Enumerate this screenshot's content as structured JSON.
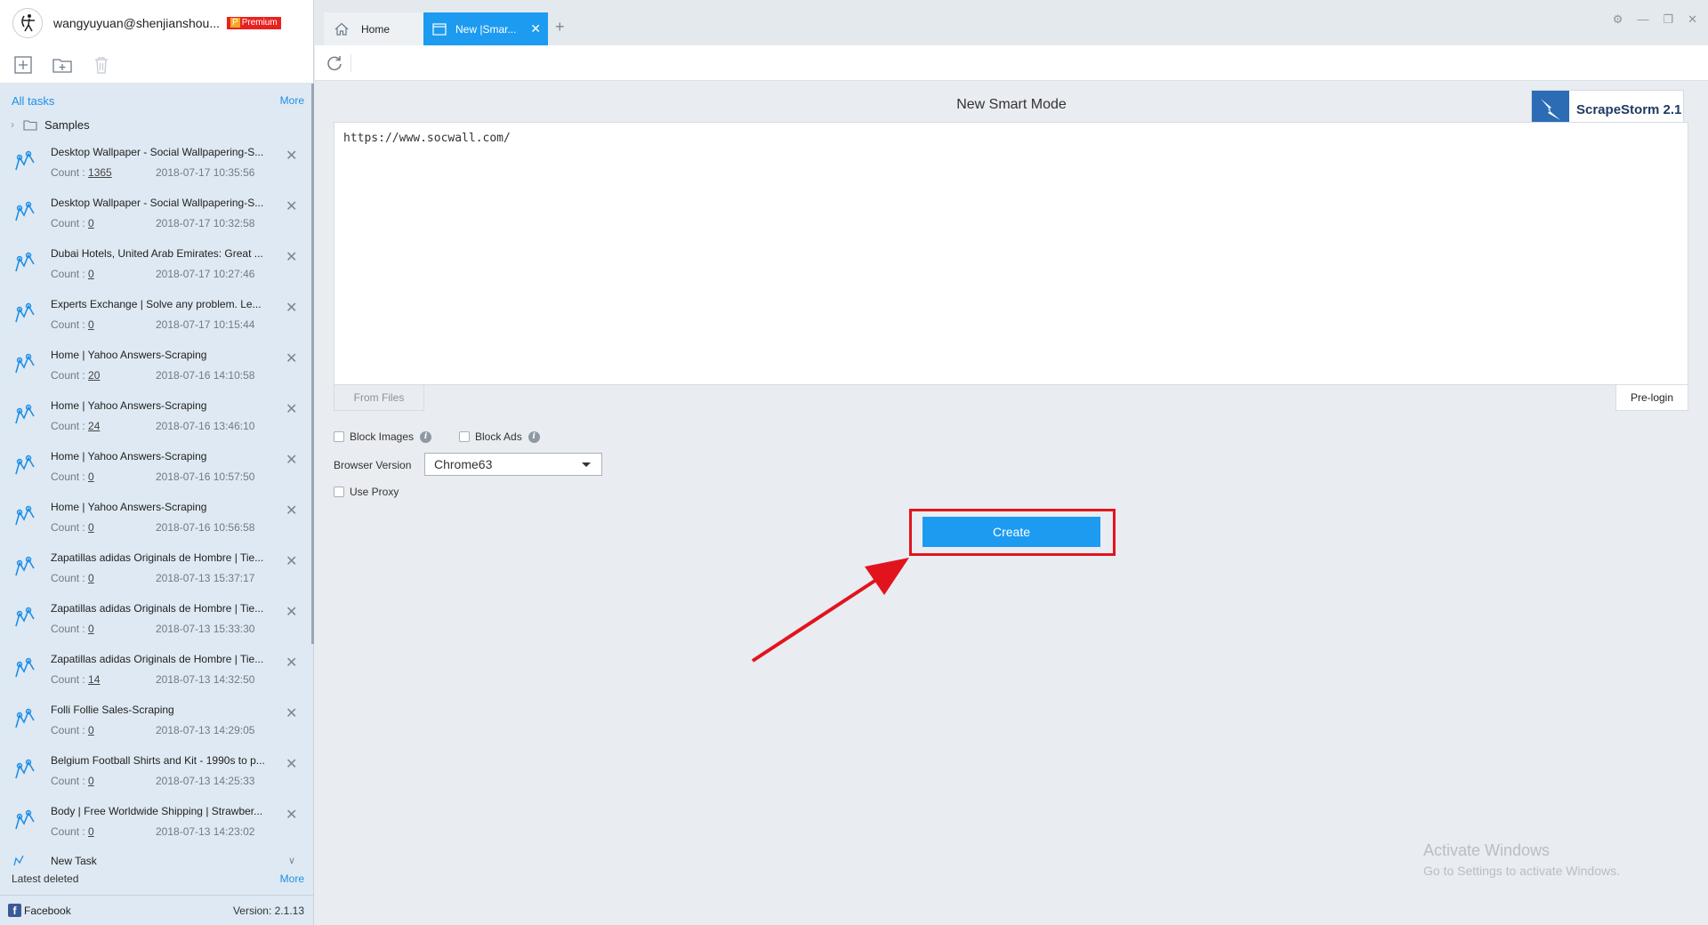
{
  "user": {
    "name": "wangyuyuan@shenjianshou...",
    "badge_p": "P",
    "badge": "Premium"
  },
  "sidebar": {
    "all_tasks": "All tasks",
    "more": "More",
    "samples": "Samples",
    "tasks": [
      {
        "title": "Desktop Wallpaper - Social Wallpapering-S...",
        "count_label": "Count : ",
        "count": "1365",
        "date": "2018-07-17 10:35:56"
      },
      {
        "title": "Desktop Wallpaper - Social Wallpapering-S...",
        "count_label": "Count : ",
        "count": "0",
        "date": "2018-07-17 10:32:58"
      },
      {
        "title": "Dubai Hotels, United Arab Emirates: Great ...",
        "count_label": "Count : ",
        "count": "0",
        "date": "2018-07-17 10:27:46"
      },
      {
        "title": "Experts Exchange | Solve any problem. Le...",
        "count_label": "Count : ",
        "count": "0",
        "date": "2018-07-17 10:15:44"
      },
      {
        "title": "Home | Yahoo Answers-Scraping",
        "count_label": "Count : ",
        "count": "20",
        "date": "2018-07-16 14:10:58"
      },
      {
        "title": "Home | Yahoo Answers-Scraping",
        "count_label": "Count : ",
        "count": "24",
        "date": "2018-07-16 13:46:10"
      },
      {
        "title": "Home | Yahoo Answers-Scraping",
        "count_label": "Count : ",
        "count": "0",
        "date": "2018-07-16 10:57:50"
      },
      {
        "title": "Home | Yahoo Answers-Scraping",
        "count_label": "Count : ",
        "count": "0",
        "date": "2018-07-16 10:56:58"
      },
      {
        "title": "Zapatillas adidas Originals de Hombre | Tie...",
        "count_label": "Count : ",
        "count": "0",
        "date": "2018-07-13 15:37:17"
      },
      {
        "title": "Zapatillas adidas Originals de Hombre | Tie...",
        "count_label": "Count : ",
        "count": "0",
        "date": "2018-07-13 15:33:30"
      },
      {
        "title": "Zapatillas adidas Originals de Hombre | Tie...",
        "count_label": "Count : ",
        "count": "14",
        "date": "2018-07-13 14:32:50"
      },
      {
        "title": "Folli Follie Sales-Scraping",
        "count_label": "Count : ",
        "count": "0",
        "date": "2018-07-13 14:29:05"
      },
      {
        "title": "Belgium Football Shirts and Kit - 1990s to p...",
        "count_label": "Count : ",
        "count": "0",
        "date": "2018-07-13 14:25:33"
      },
      {
        "title": "Body | Free Worldwide Shipping | Strawber...",
        "count_label": "Count : ",
        "count": "0",
        "date": "2018-07-13 14:23:02"
      }
    ],
    "new_task": "New Task",
    "latest_deleted": "Latest deleted",
    "deleted_more": "More",
    "facebook": "Facebook",
    "version": "Version: 2.1.13"
  },
  "tabs": {
    "home": "Home",
    "new": "New |Smar..."
  },
  "main": {
    "title": "New Smart Mode",
    "brand": "ScrapeStorm 2.1",
    "url": "https://www.socwall.com/",
    "from_files": "From Files",
    "pre_login": "Pre-login",
    "block_images": "Block Images",
    "block_ads": "Block Ads",
    "browser_version_label": "Browser Version",
    "browser_version_value": "Chrome63",
    "use_proxy": "Use Proxy",
    "create": "Create"
  },
  "watermark": {
    "title": "Activate Windows",
    "subtitle": "Go to Settings to activate Windows."
  },
  "colors": {
    "accent": "#1d9bf0",
    "highlight": "#e1141d",
    "brand": "#2b6cb5"
  }
}
